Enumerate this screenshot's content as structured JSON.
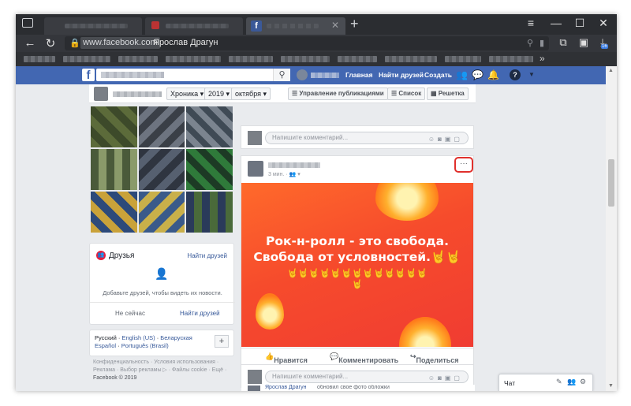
{
  "browser": {
    "tabs": [
      {
        "title": ""
      },
      {
        "title": ""
      },
      {
        "title": "",
        "favicon": "f"
      }
    ],
    "new_tab": "+",
    "window_controls": [
      "≡",
      "—",
      "☐",
      "✕"
    ],
    "address": {
      "domain": "www.facebook.com",
      "page_title": "Ярослав Драгун"
    },
    "download_badge": "16",
    "bookmarks_more": "»"
  },
  "fb": {
    "logo": "f",
    "nav": {
      "home": "Главная",
      "find_friends": "Найти друзей",
      "create": "Создать"
    }
  },
  "timeline_nav": {
    "chronicle": "Хроника",
    "year": "2019",
    "month": "октября",
    "manage_posts": "Управление публикациями",
    "list": "Список",
    "grid": "Решетка"
  },
  "friends": {
    "title": "Друзья",
    "find_friends": "Найти друзей",
    "empty_text": "Добавьте друзей, чтобы видеть их новости.",
    "not_now": "Не сейчас",
    "find_friends_btn": "Найти друзей"
  },
  "languages": {
    "line1": [
      "Русский",
      "English (US)",
      "Беларуская"
    ],
    "line2": [
      "Español",
      "Português (Brasil)"
    ],
    "add": "+"
  },
  "footer": {
    "line1": "Конфиденциальность · Условия использования ·",
    "line2": "Реклама · Выбор рекламы ▷ · Файлы cookie · Ещё ·",
    "line3": "Facebook © 2019"
  },
  "composer": {
    "placeholder": "Напишите комментарий..."
  },
  "post": {
    "time": "3 мин. · ",
    "banner_line1": "Рок-н-ролл - это свобода.",
    "banner_line2": "Свобода от условностей.🤘🤘",
    "horns_row": "🤘🤘🤘🤘🤘🤘🤘🤘🤘🤘🤘🤘🤘",
    "horn_single": "🤘",
    "like": "Нравится",
    "comment": "Комментировать",
    "share": "Поделиться",
    "more": "···"
  },
  "next_post": {
    "author": "Ярослав Драгун",
    "text": "обновил свое фото обложки"
  },
  "chat": {
    "label": "Чат"
  },
  "colors": {
    "fb_blue": "#4267b2",
    "highlight": "#e0302c",
    "banner": "#f64b2c"
  }
}
